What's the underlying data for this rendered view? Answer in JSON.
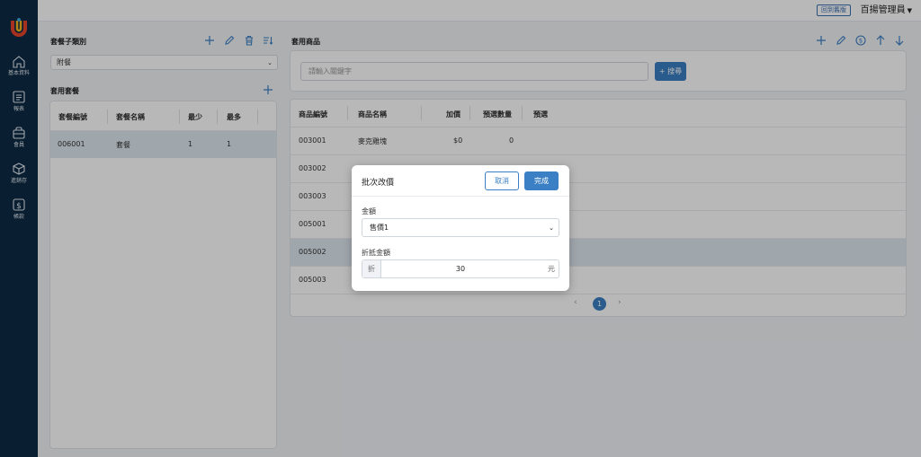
{
  "sidebar": {
    "items": [
      {
        "label": "基本資料",
        "icon": "home-icon"
      },
      {
        "label": "報表",
        "icon": "report-icon"
      },
      {
        "label": "會員",
        "icon": "member-icon"
      },
      {
        "label": "進銷存",
        "icon": "inventory-icon"
      },
      {
        "label": "帳款",
        "icon": "dollar-icon"
      }
    ]
  },
  "topbar": {
    "back_label": "回到舊版",
    "user_label": "百揚管理員"
  },
  "left_panel": {
    "category_title": "套餐子類別",
    "category_select": "附餐",
    "combo_title": "套用套餐",
    "table": {
      "headers": [
        "套餐編號",
        "套餐名稱",
        "最少",
        "最多"
      ],
      "rows": [
        [
          "006001",
          "套餐",
          "1",
          "1"
        ]
      ]
    }
  },
  "right_panel": {
    "title": "套用商品",
    "search_placeholder": "請輸入關鍵字",
    "search_button": "+ 搜尋",
    "table": {
      "headers": [
        "商品編號",
        "商品名稱",
        "加價",
        "預選數量",
        "預選"
      ],
      "rows": [
        [
          "003001",
          "麥克雞塊",
          "$0",
          "0"
        ],
        [
          "003002",
          "",
          "",
          ""
        ],
        [
          "003003",
          "",
          "",
          ""
        ],
        [
          "005001",
          "",
          "",
          ""
        ],
        [
          "005002",
          "",
          "",
          ""
        ],
        [
          "005003",
          "",
          "",
          ""
        ]
      ]
    },
    "pagination": {
      "prev": "‹",
      "current": "1",
      "next": "›"
    }
  },
  "modal": {
    "title": "批次改價",
    "cancel_label": "取消",
    "done_label": "完成",
    "amount_label": "金額",
    "amount_select": "售價1",
    "discount_label": "折抵金額",
    "discount_prefix": "折",
    "discount_value": "30",
    "discount_suffix": "元"
  },
  "colors": {
    "sidebar": "#0d2b44",
    "accent": "#3b7fc4"
  }
}
